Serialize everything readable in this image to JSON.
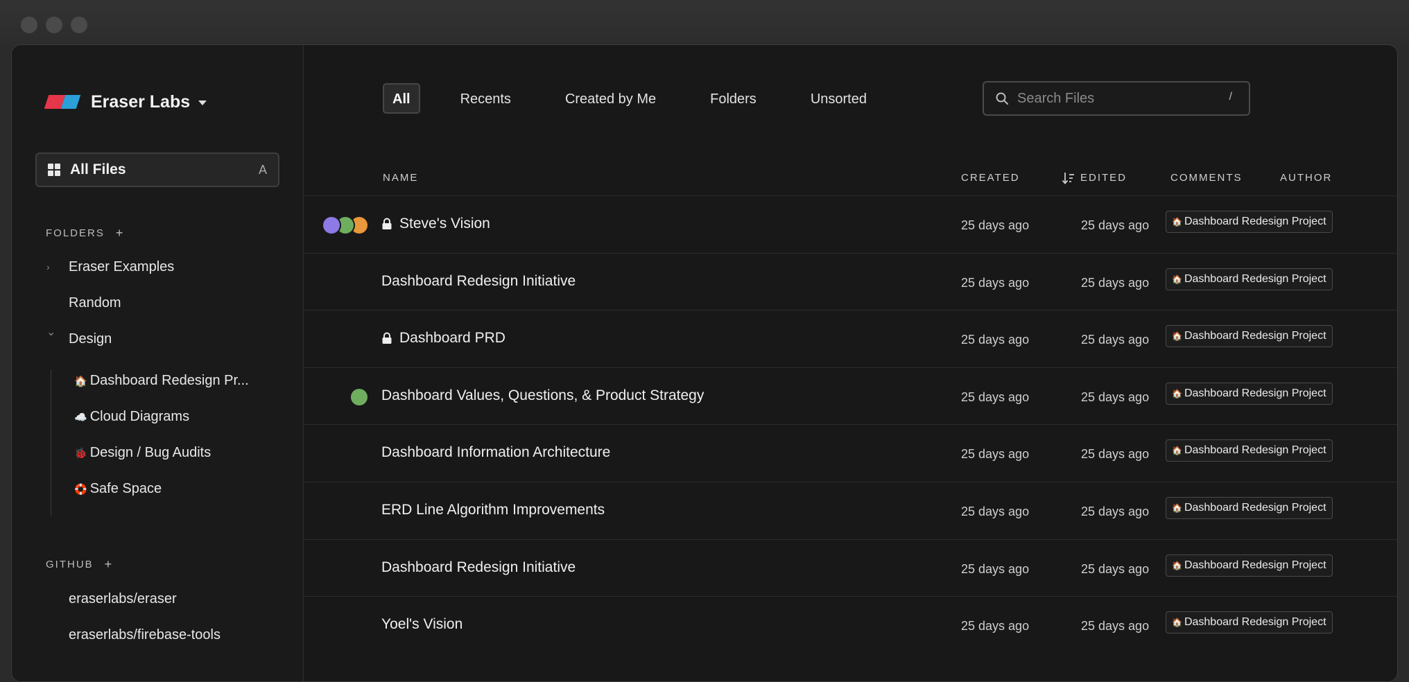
{
  "app": {
    "workspace_name": "Eraser Labs",
    "all_files_label": "All Files",
    "all_files_shortcut": "A"
  },
  "sidebar": {
    "folders_label": "FOLDERS",
    "add_symbol": "+",
    "folders": [
      {
        "label": "Eraser Examples",
        "chevron": "›"
      },
      {
        "label": "Random",
        "chevron": ""
      },
      {
        "label": "Design",
        "chevron": "⌄"
      }
    ],
    "subfolders": [
      {
        "emoji": "🏠",
        "label": "Dashboard Redesign Pr..."
      },
      {
        "emoji": "☁️",
        "label": "Cloud Diagrams"
      },
      {
        "emoji": "🐞",
        "label": "Design / Bug Audits"
      },
      {
        "emoji": "🛟",
        "label": "Safe Space"
      }
    ],
    "github_label": "GITHUB",
    "repos": [
      {
        "label": "eraserlabs/eraser"
      },
      {
        "label": "eraserlabs/firebase-tools"
      }
    ]
  },
  "tabs": [
    {
      "label": "All",
      "active": true
    },
    {
      "label": "Recents",
      "active": false
    },
    {
      "label": "Created by Me",
      "active": false
    },
    {
      "label": "Folders",
      "active": false
    },
    {
      "label": "Unsorted",
      "active": false
    }
  ],
  "search": {
    "placeholder": "Search Files",
    "shortcut": "/"
  },
  "table": {
    "columns": {
      "name": "NAME",
      "created": "CREATED",
      "edited": "EDITED",
      "comments": "COMMENTS",
      "author": "AUTHOR"
    },
    "rows": [
      {
        "title": "Steve's Vision",
        "locked": true,
        "avatars": [
          "#8d7ae6",
          "#6fae5f",
          "#e8973a"
        ],
        "created": "25 days ago",
        "edited": "25 days ago",
        "badge_emoji": "🏠",
        "badge": "Dashboard Redesign Project"
      },
      {
        "title": "Dashboard Redesign Initiative",
        "locked": false,
        "avatars": [],
        "created": "25 days ago",
        "edited": "25 days ago",
        "badge_emoji": "🏠",
        "badge": "Dashboard Redesign Project"
      },
      {
        "title": "Dashboard PRD",
        "locked": true,
        "avatars": [],
        "created": "25 days ago",
        "edited": "25 days ago",
        "badge_emoji": "🏠",
        "badge": "Dashboard Redesign Project"
      },
      {
        "title": "Dashboard Values, Questions, & Product Strategy",
        "locked": false,
        "avatars": [
          "#6fae5f"
        ],
        "created": "25 days ago",
        "edited": "25 days ago",
        "badge_emoji": "🏠",
        "badge": "Dashboard Redesign Project"
      },
      {
        "title": "Dashboard Information Architecture",
        "locked": false,
        "avatars": [],
        "created": "25 days ago",
        "edited": "25 days ago",
        "badge_emoji": "🏠",
        "badge": "Dashboard Redesign Project"
      },
      {
        "title": "ERD Line Algorithm Improvements",
        "locked": false,
        "avatars": [],
        "created": "25 days ago",
        "edited": "25 days ago",
        "badge_emoji": "🏠",
        "badge": "Dashboard Redesign Project"
      },
      {
        "title": "Dashboard Redesign Initiative",
        "locked": false,
        "avatars": [],
        "created": "25 days ago",
        "edited": "25 days ago",
        "badge_emoji": "🏠",
        "badge": "Dashboard Redesign Project"
      },
      {
        "title": "Yoel's Vision",
        "locked": false,
        "avatars": [],
        "created": "25 days ago",
        "edited": "25 days ago",
        "badge_emoji": "🏠",
        "badge": "Dashboard Redesign Project"
      }
    ]
  },
  "icons": {
    "logo": "eraser-logo-icon",
    "all_files": "grid-icon",
    "search": "search-icon",
    "sort": "sort-descending-icon",
    "lock": "lock-icon"
  }
}
